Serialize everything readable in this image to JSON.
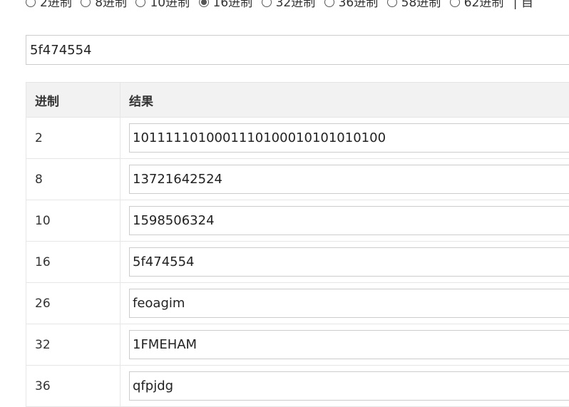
{
  "radix_options": [
    {
      "label": "2进制",
      "checked": false
    },
    {
      "label": "8进制",
      "checked": false
    },
    {
      "label": "10进制",
      "checked": false
    },
    {
      "label": "16进制",
      "checked": true
    },
    {
      "label": "32进制",
      "checked": false
    },
    {
      "label": "36进制",
      "checked": false
    },
    {
      "label": "58进制",
      "checked": false
    },
    {
      "label": "62进制",
      "checked": false
    }
  ],
  "radix_separator": "| 自",
  "input": {
    "value": "5f474554"
  },
  "table": {
    "headers": {
      "base": "进制",
      "result": "结果"
    },
    "rows": [
      {
        "base": "2",
        "result": "1011111010001110100010101010100"
      },
      {
        "base": "8",
        "result": "13721642524"
      },
      {
        "base": "10",
        "result": "1598506324"
      },
      {
        "base": "16",
        "result": "5f474554"
      },
      {
        "base": "26",
        "result": "feoagim"
      },
      {
        "base": "32",
        "result": "1FMEHAM"
      },
      {
        "base": "36",
        "result": "qfpjdg"
      }
    ]
  }
}
